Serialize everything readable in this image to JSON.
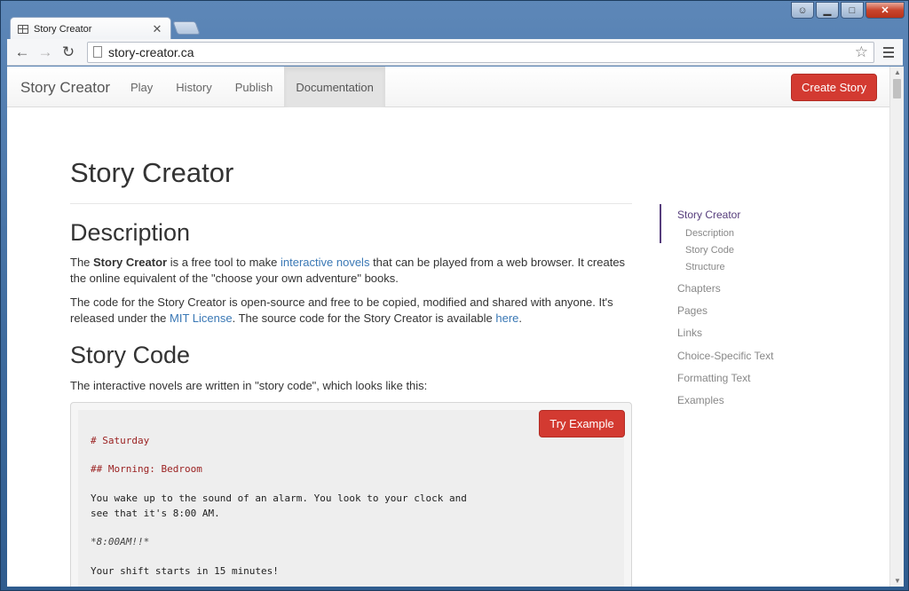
{
  "browser": {
    "tab_title": "Story Creator",
    "url": "story-creator.ca"
  },
  "site": {
    "brand": "Story Creator",
    "nav": [
      "Play",
      "History",
      "Publish",
      "Documentation"
    ],
    "active_nav": "Documentation",
    "create_button": "Create Story"
  },
  "main": {
    "title": "Story Creator",
    "description_heading": "Description",
    "p1": {
      "t1": "The ",
      "bold": "Story Creator",
      "t2": " is a free tool to make ",
      "link": "interactive novels",
      "t3": " that can be played from a web browser. It creates the online equivalent of the \"choose your own adventure\" books."
    },
    "p2": {
      "t1": "The code for the Story Creator is open-source and free to be copied, modified and shared with anyone. It's released under the ",
      "link1": "MIT License",
      "t2": ". The source code for the Story Creator is available ",
      "link2": "here",
      "t3": "."
    },
    "story_code_heading": "Story Code",
    "p3": "The interactive novels are written in \"story code\", which looks like this:",
    "try_button": "Try Example",
    "code_lines": [
      "# Saturday",
      "## Morning: Bedroom",
      "You wake up to the sound of an alarm. You look to your clock and",
      "see that it's 8:00 AM.",
      "*8:00AM!!*",
      "Your shift starts in 15 minutes!"
    ]
  },
  "toc": {
    "items": [
      {
        "label": "Story Creator",
        "level": 1,
        "active": true
      },
      {
        "label": "Description",
        "level": 2
      },
      {
        "label": "Story Code",
        "level": 2
      },
      {
        "label": "Structure",
        "level": 2
      },
      {
        "label": "Chapters",
        "level": 1
      },
      {
        "label": "Pages",
        "level": 1
      },
      {
        "label": "Links",
        "level": 1
      },
      {
        "label": "Choice-Specific Text",
        "level": 1
      },
      {
        "label": "Formatting Text",
        "level": 1
      },
      {
        "label": "Examples",
        "level": 1
      }
    ]
  },
  "colors": {
    "accent_red": "#d33a31",
    "link_blue": "#3a78b5",
    "toc_active": "#563d7c",
    "code_heading": "#9b2222"
  }
}
